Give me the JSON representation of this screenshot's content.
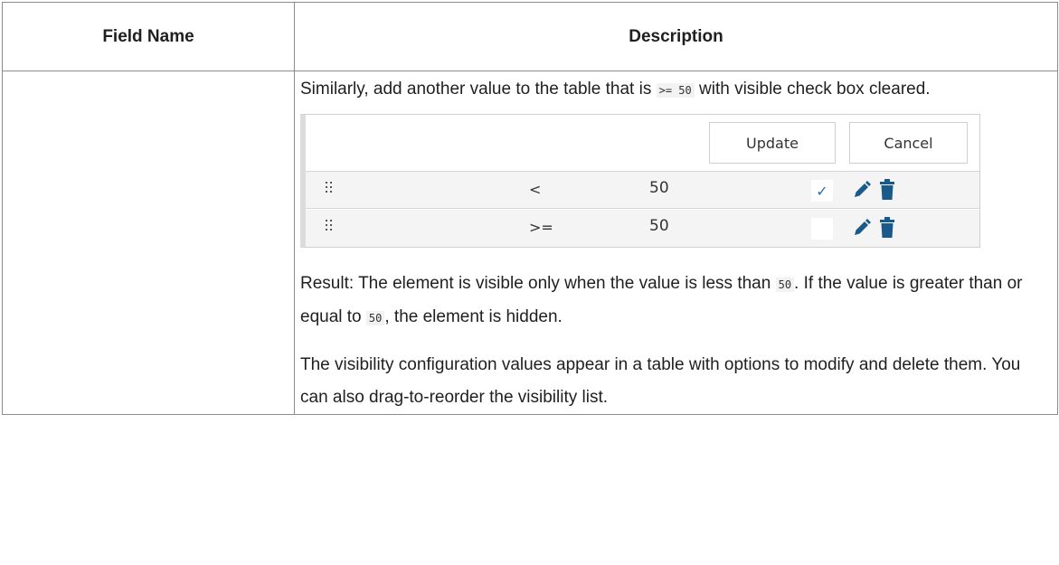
{
  "header": {
    "field_name": "Field Name",
    "description": "Description"
  },
  "paragraph1": {
    "before": "Similarly, add another value to the table that is ",
    "code": ">= 50",
    "after": " with visible check box cleared."
  },
  "widget": {
    "update_label": "Update",
    "cancel_label": "Cancel",
    "rows": [
      {
        "operator": "<",
        "value": "50",
        "visible": true,
        "check_glyph": "✓"
      },
      {
        "operator": ">=",
        "value": "50",
        "visible": false,
        "check_glyph": ""
      }
    ],
    "icons": {
      "drag": "drag-handle-icon",
      "edit": "pencil-icon",
      "delete": "trash-icon"
    },
    "icon_color": "#1a5a8a"
  },
  "paragraph2": {
    "part1": "Result: The element is visible only when the value is less than ",
    "code1": "50",
    "part2": ". If the value is greater than or equal to ",
    "code2": "50",
    "part3": ", the element is hidden."
  },
  "paragraph3": {
    "text": "The visibility configuration values appear in a table with options to modify and delete them. You can also drag-to-reorder the visibility list."
  }
}
